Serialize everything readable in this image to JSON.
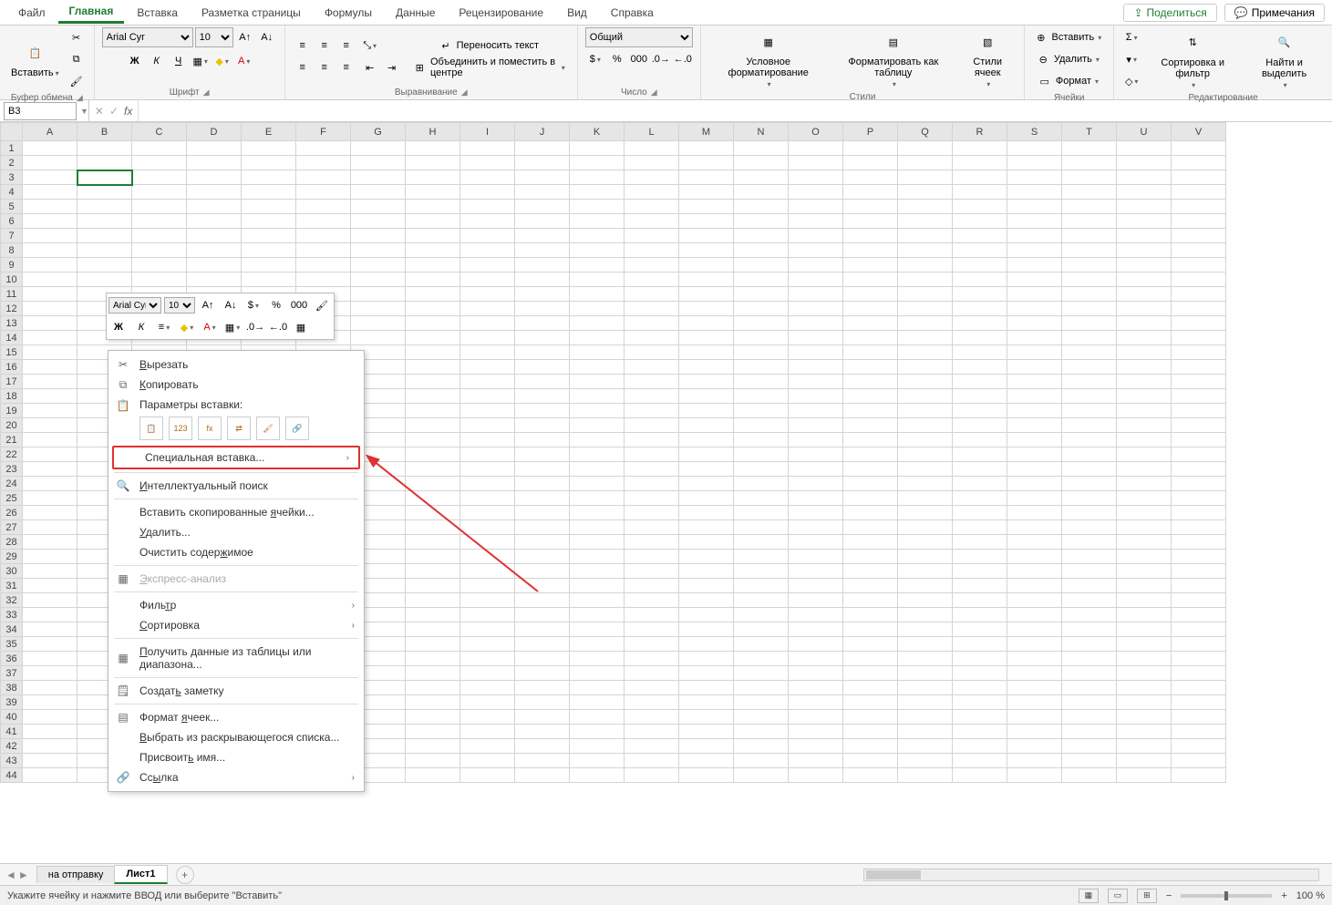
{
  "tabs": {
    "file": "Файл",
    "home": "Главная",
    "insert": "Вставка",
    "layout": "Разметка страницы",
    "formulas": "Формулы",
    "data": "Данные",
    "review": "Рецензирование",
    "view": "Вид",
    "help": "Справка",
    "share": "Поделиться",
    "comments": "Примечания"
  },
  "ribbon": {
    "clipboard": {
      "label": "Буфер обмена",
      "paste": "Вставить"
    },
    "font": {
      "label": "Шрифт",
      "name": "Arial Cyr",
      "size": "10"
    },
    "alignment": {
      "label": "Выравнивание",
      "wrap": "Переносить текст",
      "merge": "Объединить и поместить в центре"
    },
    "number": {
      "label": "Число",
      "format": "Общий"
    },
    "styles": {
      "label": "Стили",
      "cond": "Условное форматирование",
      "table": "Форматировать как таблицу",
      "cell": "Стили ячеек"
    },
    "cells": {
      "label": "Ячейки",
      "insert": "Вставить",
      "delete": "Удалить",
      "format": "Формат"
    },
    "editing": {
      "label": "Редактирование",
      "sort": "Сортировка и фильтр",
      "find": "Найти и выделить"
    }
  },
  "name_box": "B3",
  "columns": [
    "A",
    "B",
    "C",
    "D",
    "E",
    "F",
    "G",
    "H",
    "I",
    "J",
    "K",
    "L",
    "M",
    "N",
    "O",
    "P",
    "Q",
    "R",
    "S",
    "T",
    "U",
    "V"
  ],
  "mini": {
    "font": "Arial Cyr",
    "size": "10"
  },
  "ctx": {
    "cut": "Вырезать",
    "copy": "Копировать",
    "paste_opts_label": "Параметры вставки:",
    "paste_special": "Специальная вставка...",
    "smart_lookup": "Интеллектуальный поиск",
    "insert_copied": "Вставить скопированные ячейки...",
    "delete": "Удалить...",
    "clear": "Очистить содержимое",
    "quick_analysis": "Экспресс-анализ",
    "filter": "Фильтр",
    "sort": "Сортировка",
    "get_data": "Получить данные из таблицы или диапазона...",
    "new_note": "Создать заметку",
    "format_cells": "Формат ячеек...",
    "pick_list": "Выбрать из раскрывающегося списка...",
    "define_name": "Присвоить имя...",
    "link": "Ссылка"
  },
  "sheets": {
    "s1": "на отправку",
    "s2": "Лист1"
  },
  "status": {
    "msg": "Укажите ячейку и нажмите ВВОД или выберите \"Вставить\"",
    "zoom": "100 %"
  }
}
